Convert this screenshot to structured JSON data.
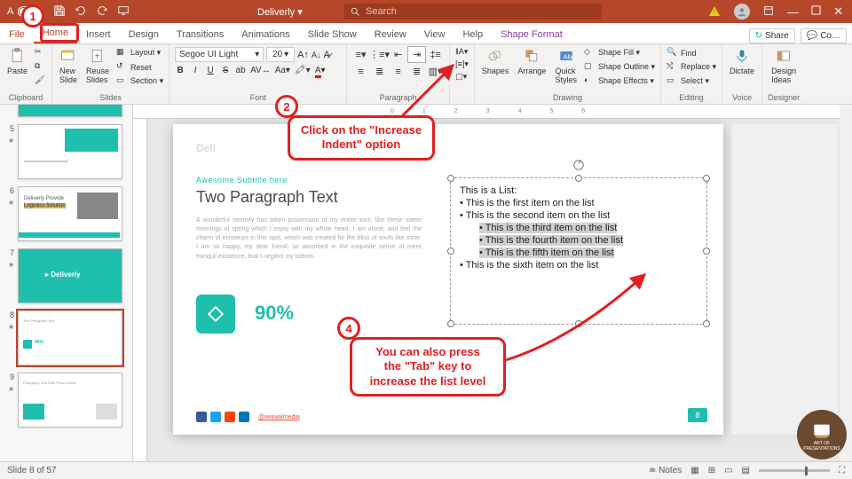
{
  "titlebar": {
    "autosave": "A",
    "autosave_state": "Off",
    "doc_title": "Deliverly  ▾",
    "search_placeholder": "Search"
  },
  "tabs": {
    "file": "File",
    "home": "Home",
    "insert": "Insert",
    "design": "Design",
    "transitions": "Transitions",
    "animations": "Animations",
    "slideshow": "Slide Show",
    "review": "Review",
    "view": "View",
    "help": "Help",
    "shape_format": "Shape Format",
    "share": "Share",
    "comments": "Co…"
  },
  "ribbon": {
    "clipboard": {
      "label": "Clipboard",
      "paste": "Paste"
    },
    "slides": {
      "label": "Slides",
      "new_slide": "New\nSlide",
      "reuse": "Reuse\nSlides",
      "layout": "Layout ▾",
      "reset": "Reset",
      "section": "Section ▾"
    },
    "font": {
      "label": "Font",
      "family": "Segoe UI Light",
      "size": "20"
    },
    "paragraph": {
      "label": "Paragraph"
    },
    "drawing": {
      "label": "Drawing",
      "shapes": "Shapes",
      "arrange": "Arrange",
      "quick": "Quick\nStyles",
      "fill": "Shape Fill ▾",
      "outline": "Shape Outline ▾",
      "effects": "Shape Effects ▾"
    },
    "editing": {
      "label": "Editing",
      "find": "Find",
      "replace": "Replace ▾",
      "select": "Select ▾"
    },
    "voice": {
      "label": "Voice",
      "dictate": "Dictate"
    },
    "designer": {
      "label": "Designer",
      "ideas": "Design\nIdeas"
    }
  },
  "thumbs": {
    "n5": "5",
    "n6": "6",
    "n7": "7",
    "n8": "8",
    "n9": "9",
    "t6a": "Deliverly Provide",
    "t6b": "Logistics Solution",
    "t7": "Deliverly"
  },
  "slide": {
    "watermark": "Deli",
    "subtitle": "Awesome Subtitle here",
    "title": "Two Paragraph Text",
    "para": "A wonderful serenity has taken possession of my entire soul, like these sweet mornings of spring which I enjoy with my whole heart. I am alone, and feel the charm of existence in this spot, which was created for the bliss of souls like mine. I am so happy, my dear friend, so absorbed in the exquisite sense of mere tranquil existence, that I neglect my talents.",
    "pct": "90%",
    "link": "@wwwalmedia",
    "page_num": "8",
    "list_heading": "This is a List:",
    "item1": "• This is the first item on the list",
    "item2": "• This is the second item on the list",
    "item3": "• This is the third item on the list",
    "item4": "• This is the fourth item on the list",
    "item5": "• This is the fifth item on the list",
    "item6": "• This is the sixth item on the list"
  },
  "annotations": {
    "n1": "1",
    "n2": "2",
    "n4": "4",
    "callout2a": "Click on the \"Increase",
    "callout2b": "Indent\" option",
    "callout4a": "You can also press",
    "callout4b": "the \"Tab\" key to",
    "callout4c": "increase the list level"
  },
  "status": {
    "slide": "Slide 8 of 57",
    "notes": "Notes"
  },
  "ruler": "0123456",
  "logo": {
    "line1": "ART OF",
    "line2": "PRESENTATIONS"
  }
}
